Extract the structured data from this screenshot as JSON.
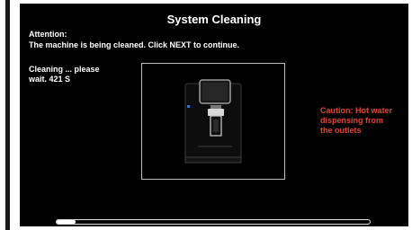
{
  "screen": {
    "title": "System Cleaning",
    "attention": "Attention:",
    "message": "The machine is being cleaned. Click NEXT to continue.",
    "status_line1": "Cleaning ... please",
    "status_line2": "wait. 421 S",
    "caution_line1": "Caution: Hot water",
    "caution_line2": "dispensing from",
    "caution_line3": "the outlets"
  },
  "illustration": {
    "icon": "coffee-machine-icon"
  },
  "progress": {
    "fraction": 0.06
  },
  "colors": {
    "background": "#000000",
    "text": "#ffffff",
    "caution": "#e8402a"
  }
}
